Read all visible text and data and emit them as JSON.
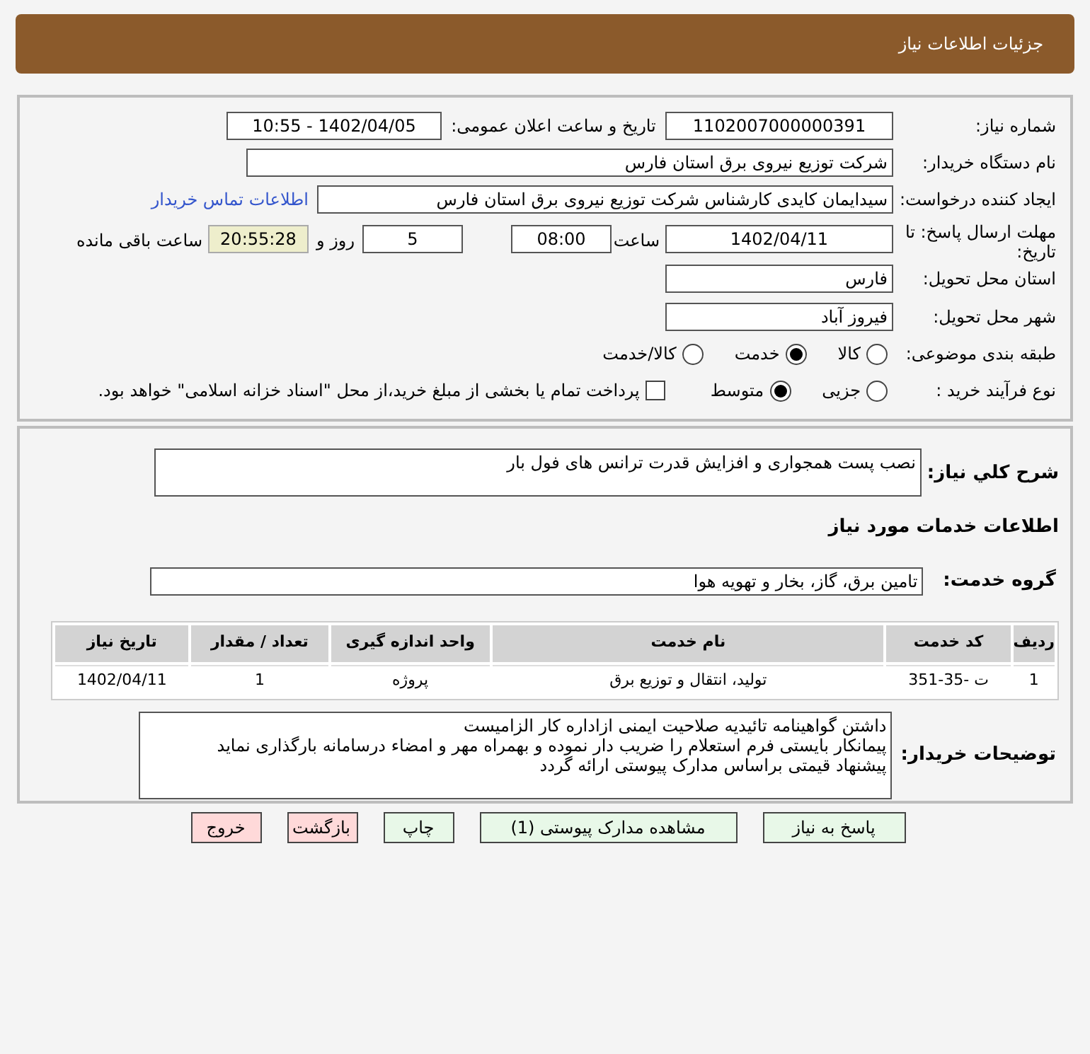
{
  "header": {
    "title": "جزئیات اطلاعات نیاز"
  },
  "need_number": {
    "label": "شماره نیاز:",
    "value": "1102007000000391"
  },
  "announce": {
    "label": "تاریخ و ساعت اعلان عمومی:",
    "value": "1402/04/05 - 10:55"
  },
  "buyer_org": {
    "label": "نام دستگاه خریدار:",
    "value": "شرکت توزیع نیروی برق استان فارس"
  },
  "requester": {
    "label": "ایجاد کننده درخواست:",
    "value": "سیدایمان کایدی کارشناس شرکت توزیع نیروی برق استان فارس",
    "link": "اطلاعات تماس خریدار"
  },
  "deadline": {
    "label": "مهلت ارسال پاسخ: تا تاریخ:",
    "date": "1402/04/11",
    "time_label": "ساعت",
    "time": "08:00",
    "days": "5",
    "days_label": "روز و",
    "remaining": "20:55:28",
    "remaining_label": "ساعت باقی مانده"
  },
  "province": {
    "label": "استان محل تحویل:",
    "value": "فارس"
  },
  "city": {
    "label": "شهر محل تحویل:",
    "value": "فیروز آباد"
  },
  "category": {
    "label": "طبقه بندی موضوعی:",
    "options": [
      {
        "label": "کالا",
        "selected": false
      },
      {
        "label": "خدمت",
        "selected": true
      },
      {
        "label": "کالا/خدمت",
        "selected": false
      }
    ]
  },
  "process": {
    "label": "نوع فرآیند خرید :",
    "options": [
      {
        "label": "جزیی",
        "selected": false
      },
      {
        "label": "متوسط",
        "selected": true
      }
    ],
    "checkbox": {
      "label": "پرداخت تمام یا بخشی از مبلغ خرید،از محل \"اسناد خزانه اسلامی\" خواهد بود.",
      "checked": false
    }
  },
  "description": {
    "label": "شرح کلي نياز:",
    "value": "نصب پست همجواری و افزایش قدرت ترانس های فول بار"
  },
  "services_title": "اطلاعات خدمات مورد نیاز",
  "service_group": {
    "label": "گروه خدمت:",
    "value": "تامین برق، گاز، بخار و تهویه هوا"
  },
  "table": {
    "columns": [
      "ردیف",
      "کد خدمت",
      "نام خدمت",
      "واحد اندازه گیری",
      "تعداد / مقدار",
      "تاریخ نیاز"
    ],
    "rows": [
      [
        "1",
        "ت -35-351",
        "تولید، انتقال و توزیع برق",
        "پروژه",
        "1",
        "1402/04/11"
      ]
    ]
  },
  "buyer_notes": {
    "label": "توضیحات خریدار:",
    "lines": [
      "داشتن گواهینامه تائیدیه صلاحیت ایمنی ازاداره کار الزامیست",
      "پیمانکار بایستی فرم استعلام را ضریب دار نموده و بهمراه مهر و امضاء درسامانه بارگذاری نماید",
      "پیشنهاد قیمتی براساس مدارک پیوستی ارائه گردد"
    ]
  },
  "buttons": [
    {
      "label": "پاسخ به نیاز",
      "kind": "normal"
    },
    {
      "label": "مشاهده مدارک پیوستی (1)",
      "kind": "normal"
    },
    {
      "label": "چاپ",
      "kind": "normal"
    },
    {
      "label": "بازگشت",
      "kind": "danger"
    },
    {
      "label": "خروج",
      "kind": "danger"
    }
  ]
}
